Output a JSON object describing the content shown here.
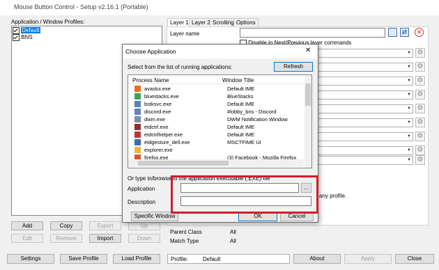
{
  "window": {
    "title": "Mouse Button Control - Setup v2.16.1 (Portable)"
  },
  "left_panel": {
    "header": "Application / Window Profiles:",
    "profiles": [
      {
        "label": "Default",
        "checked": true,
        "selected": true
      },
      {
        "label": "BNS",
        "checked": true,
        "selected": false
      }
    ],
    "buttons_row1": [
      "Add",
      "Copy",
      "Export",
      "Up"
    ],
    "buttons_row2": [
      "Edit",
      "Remove",
      "Import",
      "Down"
    ]
  },
  "tabs": [
    {
      "label": "Layer 1",
      "selected": true
    },
    {
      "label": "Layer 2",
      "selected": false
    },
    {
      "label": "Scrolling",
      "selected": false
    },
    {
      "label": "Options",
      "selected": false
    }
  ],
  "layer": {
    "name_label": "Layer name",
    "name_value": "",
    "disable_label": "Disable in Next/Previous layer commands",
    "profile_text_partial": "any profile."
  },
  "info": {
    "parent_class_label": "Parent Class",
    "parent_class_value": "All",
    "match_type_label": "Match Type",
    "match_type_value": "All"
  },
  "bottom_bar": {
    "settings": "Settings",
    "save_profile": "Save Profile",
    "load_profile": "Load Profile",
    "profile_label": "Profile:",
    "profile_value": "Default",
    "about": "About",
    "apply": "Apply",
    "close": "Close"
  },
  "dialog": {
    "title": "Choose Application",
    "close_glyph": "✕",
    "instruction": "Select from the list of running applications:",
    "refresh": "Refresh",
    "col_process": "Process Name",
    "col_window": "Window Title",
    "rows": [
      {
        "process": "avastui.exe",
        "window": "Default IME",
        "icon_color": "#e8711b"
      },
      {
        "process": "bluestacks.exe",
        "window": "BlueStacks",
        "icon_color": "#3aa655"
      },
      {
        "process": "bstksvc.exe",
        "window": "Default IME",
        "icon_color": "#5b7fb8"
      },
      {
        "process": "discord.exe",
        "window": "#lobby_bns - Discord",
        "icon_color": "#6b7fc9"
      },
      {
        "process": "dwm.exe",
        "window": "DWM Notification Window",
        "icon_color": "#7d8ea8"
      },
      {
        "process": "etdctrl.exe",
        "window": "Default IME",
        "icon_color": "#9c2b2b"
      },
      {
        "process": "etdctrlhelper.exe",
        "window": "Default IME",
        "icon_color": "#b33a3a"
      },
      {
        "process": "etdgesture_dell.exe",
        "window": "MSCTFIME UI",
        "icon_color": "#3b6ea8"
      },
      {
        "process": "explorer.exe",
        "window": "",
        "icon_color": "#e8b93a"
      },
      {
        "process": "firefox.exe",
        "window": "(3) Facebook - Mozilla Firefox",
        "icon_color": "#e0562b"
      }
    ],
    "type_in_label": "Or type in/browse to the application executable (.EXE) file",
    "application_label": "Application",
    "application_value": "",
    "browse": "...",
    "description_label": "Description",
    "description_value": "",
    "specific_window": "Specific Window",
    "ok": "OK",
    "cancel": "Cancel"
  },
  "colors": {
    "selection": "#0078d7",
    "highlight_box": "#d11e2c"
  }
}
